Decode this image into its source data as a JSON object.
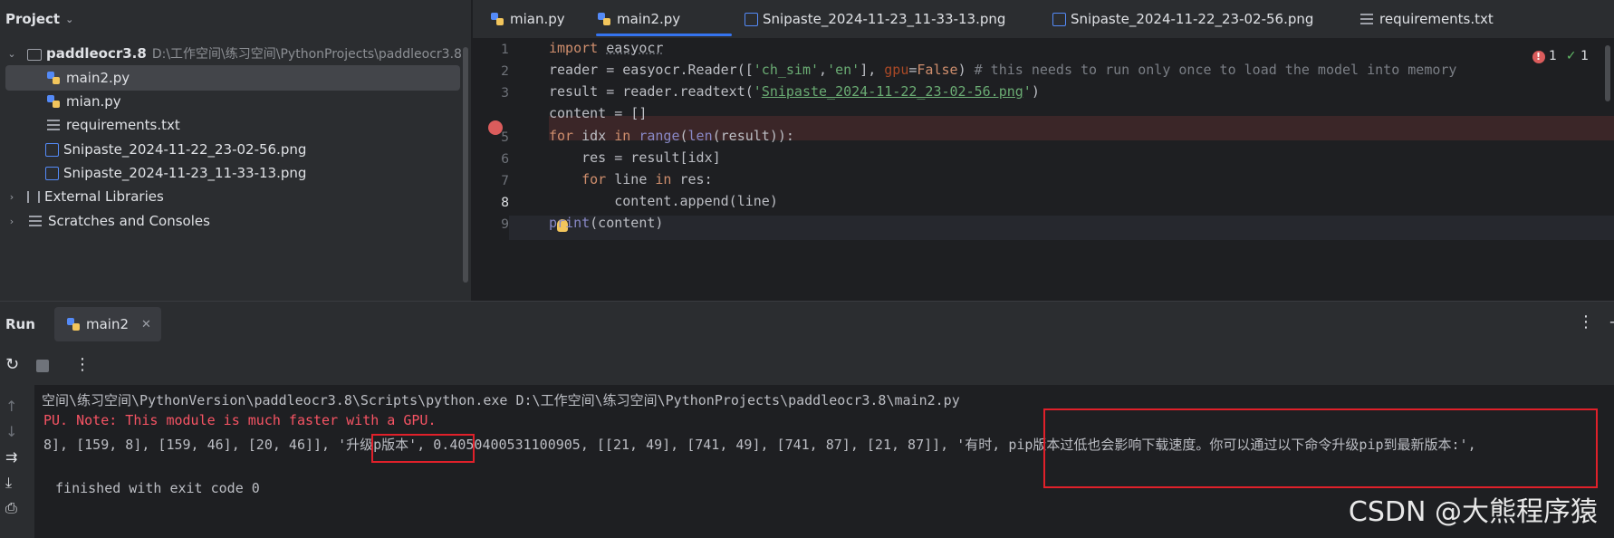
{
  "project": {
    "title": "Project",
    "root_name": "paddleocr3.8",
    "root_path": "D:\\工作空间\\练习空间\\PythonProjects\\paddleocr3.8",
    "files": [
      "main2.py",
      "mian.py",
      "requirements.txt",
      "Snipaste_2024-11-22_23-02-56.png",
      "Snipaste_2024-11-23_11-33-13.png"
    ],
    "external_libraries": "External Libraries",
    "scratches": "Scratches and Consoles"
  },
  "tabs": [
    "mian.py",
    "main2.py",
    "Snipaste_2024-11-23_11-33-13.png",
    "Snipaste_2024-11-22_23-02-56.png",
    "requirements.txt"
  ],
  "inspection": {
    "errors": "1",
    "ok": "1"
  },
  "editor": {
    "line_numbers": [
      "1",
      "2",
      "3",
      "4",
      "5",
      "6",
      "7",
      "8",
      "9"
    ]
  },
  "run": {
    "title": "Run",
    "config_tab": "main2",
    "console": {
      "cmd": "空间\\练习空间\\PythonVersion\\paddleocr3.8\\Scripts\\python.exe D:\\工作空间\\练习空间\\PythonProjects\\paddleocr3.8\\main2.py",
      "warning": "PU. Note: This module is much faster with a GPU.",
      "result_a": "8], [159, 8], [159, 46], [20, 46]], ",
      "result_b": "'升级p版本'",
      "result_c": ", 0.4050400531100905, [[21, 49], [741, 49], [741, 87], [21, 87]], ",
      "result_d": "'有时, pip版本过低也会影响下载速度。你可以通过以下命令升级pip到最新版本:',",
      "exit": " finished with exit code 0"
    }
  },
  "watermark": "CSDN @大熊程序猿",
  "colors": {
    "accent": "#3574f0",
    "breakpoint": "#db5c5c",
    "error_text": "#f75464",
    "highlight_box": "#e0202a"
  }
}
